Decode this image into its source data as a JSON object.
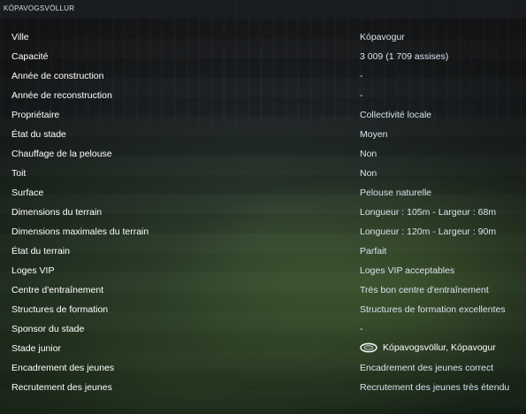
{
  "header": {
    "title": "KÓPAVOGSVÖLLUR"
  },
  "rows": [
    {
      "label": "Ville",
      "value": "Kópavogur"
    },
    {
      "label": "Capacité",
      "value": "3 009 (1 709 assises)"
    },
    {
      "label": "Année de construction",
      "value": "-"
    },
    {
      "label": "Année de reconstruction",
      "value": "-"
    },
    {
      "label": "Propriétaire",
      "value": "Collectivité locale"
    },
    {
      "label": "État du stade",
      "value": "Moyen"
    },
    {
      "label": "Chauffage de la pelouse",
      "value": "Non"
    },
    {
      "label": "Toit",
      "value": "Non"
    },
    {
      "label": "Surface",
      "value": "Pelouse naturelle"
    },
    {
      "label": "Dimensions du terrain",
      "value": "Longueur : 105m - Largeur : 68m"
    },
    {
      "label": "Dimensions maximales du terrain",
      "value": "Longueur : 120m - Largeur : 90m"
    },
    {
      "label": "État du terrain",
      "value": "Parfait"
    },
    {
      "label": "Loges VIP",
      "value": "Loges VIP acceptables"
    },
    {
      "label": "Centre d'entraînement",
      "value": "Très bon centre d'entraînement"
    },
    {
      "label": "Structures de formation",
      "value": "Structures de formation excellentes"
    },
    {
      "label": "Sponsor du stade",
      "value": "-"
    },
    {
      "label": "Stade junior",
      "value": "Kópavogsvöllur, Kópavogur",
      "icon": "stadium-icon"
    },
    {
      "label": "Encadrement des jeunes",
      "value": "Encadrement des jeunes correct"
    },
    {
      "label": "Recrutement des jeunes",
      "value": "Recrutement des jeunes très étendu"
    }
  ]
}
